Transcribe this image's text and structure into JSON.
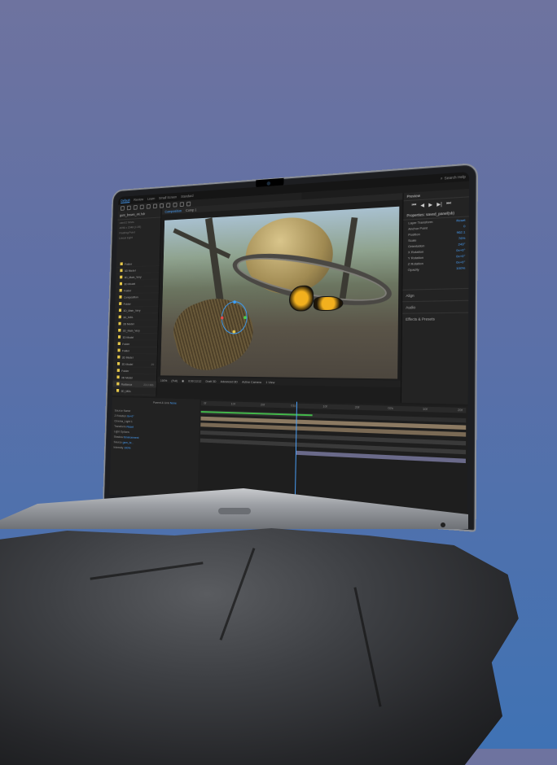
{
  "scene": {
    "background_top": "#6e739f",
    "background_bottom": "#3f72b4",
    "accent": "#4aa3ff"
  },
  "app": {
    "workspaces": [
      "Default",
      "Review",
      "Learn",
      "Small Screen",
      "Standard"
    ],
    "active_workspace": "Default",
    "search_label": "Search Help"
  },
  "project": {
    "file_name": "gum_brown_4K.hdr",
    "info": "used 2 times",
    "info2": "4096 x 2048 (1.00)",
    "layer_type": "Floating Point",
    "light": "Linear Light",
    "items": [
      {
        "name": "Folder",
        "size": ""
      },
      {
        "name": "3D Model",
        "size": ""
      },
      {
        "name": "3D_Main_Very",
        "size": ""
      },
      {
        "name": "3D Model",
        "size": ""
      },
      {
        "name": "Folder",
        "size": ""
      },
      {
        "name": "Composition",
        "size": ""
      },
      {
        "name": "Folder",
        "size": ""
      },
      {
        "name": "3D_Main_Very",
        "size": ""
      },
      {
        "name": "3D_MDL",
        "size": ""
      },
      {
        "name": "3D Model",
        "size": ""
      },
      {
        "name": "3D_Main_Very",
        "size": ""
      },
      {
        "name": "3D Model",
        "size": ""
      },
      {
        "name": "Folder",
        "size": ""
      },
      {
        "name": "Folder",
        "size": ""
      },
      {
        "name": "3D Model",
        "size": ""
      },
      {
        "name": "3D Model",
        "size": "29"
      },
      {
        "name": "Folder",
        "size": ""
      },
      {
        "name": "3D Model",
        "size": ""
      },
      {
        "name": "Radiance",
        "size": "23.0 MB"
      },
      {
        "name": "3D_MDL",
        "size": ""
      }
    ]
  },
  "viewer": {
    "tabs": [
      "Composition",
      "Comp 1"
    ],
    "active_tab": "Composition",
    "zoom": "100%",
    "resolution": "(Full)",
    "timecode": "0:00:13:12",
    "renderer": "Draft 3D",
    "renderer2": "Advanced 3D",
    "camera": "Active Camera",
    "views": "1 View"
  },
  "right_panel": {
    "preview_label": "Preview",
    "layer_title": "Properties: saved_panel(sb)",
    "transform_label": "Layer Transform",
    "reset_label": "Reset",
    "props": [
      {
        "name": "Anchor Point",
        "value": "0"
      },
      {
        "name": "Position",
        "value": "962.1"
      },
      {
        "name": "Scale",
        "value": "76%"
      },
      {
        "name": "Orientation",
        "value": "243°"
      },
      {
        "name": "X Rotation",
        "value": "0x+0°"
      },
      {
        "name": "Y Rotation",
        "value": "0x+0°"
      },
      {
        "name": "Z Rotation",
        "value": "0x+0°"
      },
      {
        "name": "Opacity",
        "value": "100%"
      }
    ],
    "sections": [
      "Align",
      "Audio",
      "Effects & Presets"
    ]
  },
  "timeline": {
    "ruler": [
      "0f",
      "10f",
      "20f",
      "01s",
      "10f",
      "20f",
      "02s",
      "10f",
      "20f"
    ],
    "rows": [
      {
        "name": "Source Name",
        "value": ""
      },
      {
        "name": "Z Rotation",
        "value": "0x+0°"
      },
      {
        "name": "Cinema_Light 1",
        "value": ""
      },
      {
        "name": "Transform",
        "value": "Reset"
      },
      {
        "name": "Light Options",
        "value": ""
      },
      {
        "name": "Shadow",
        "value": "Environment"
      },
      {
        "name": "Source",
        "value": "gum_br..."
      },
      {
        "name": "Intensity",
        "value": "100%"
      }
    ],
    "parent_label": "Parent & Link",
    "parent_value": "None"
  }
}
